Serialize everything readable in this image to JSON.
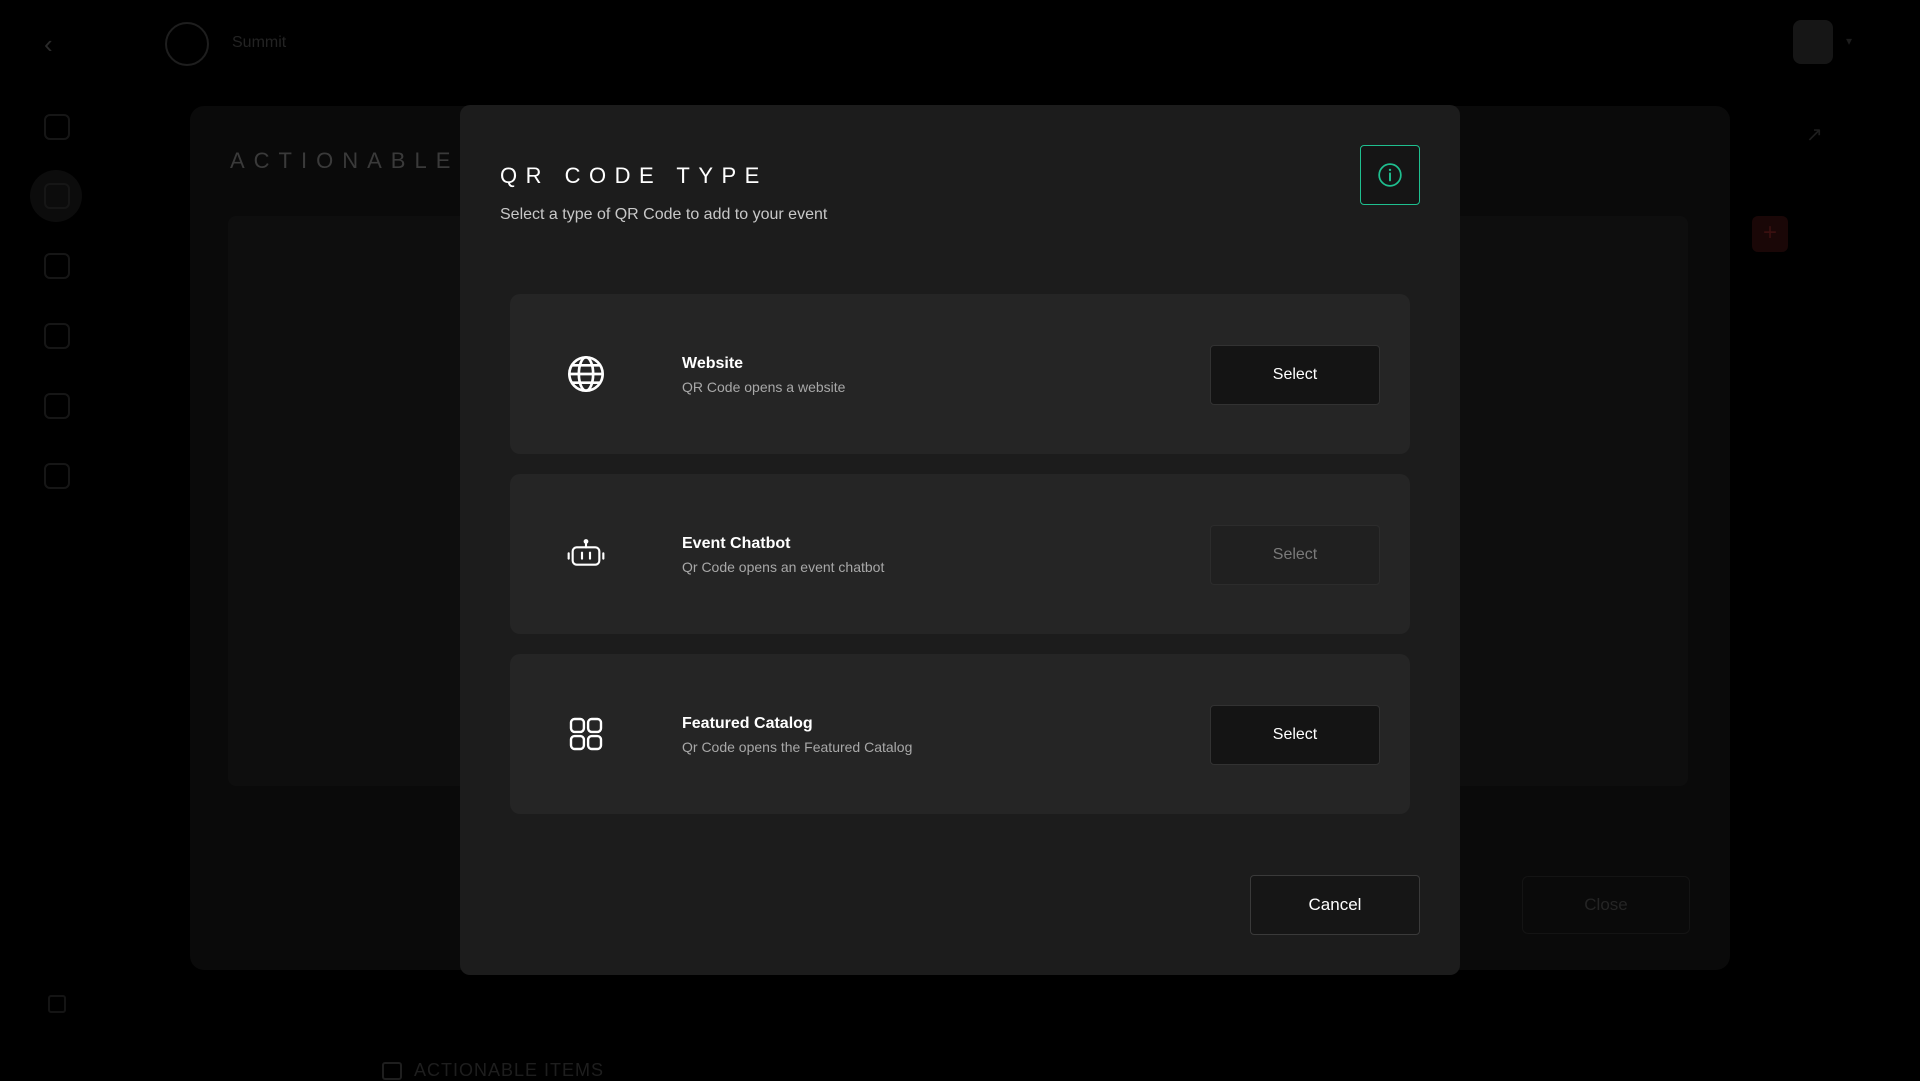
{
  "background": {
    "brand_name": "Summit",
    "page_title": "ACTIONABLE I",
    "close_label": "Close",
    "footer_label": "ACTIONABLE ITEMS"
  },
  "modal": {
    "title": "QR CODE TYPE",
    "subtitle": "Select a type of QR Code to add to your event",
    "info_icon": "info-icon",
    "accent_color": "#1fbf8f",
    "options": [
      {
        "title": "Website",
        "description": "QR Code opens a website",
        "icon": "globe-icon",
        "button_label": "Select",
        "enabled": true
      },
      {
        "title": "Event Chatbot",
        "description": "Qr Code opens an event chatbot",
        "icon": "robot-icon",
        "button_label": "Select",
        "enabled": false
      },
      {
        "title": "Featured Catalog",
        "description": "Qr Code opens the Featured Catalog",
        "icon": "grid-icon",
        "button_label": "Select",
        "enabled": true
      }
    ],
    "cancel_label": "Cancel"
  }
}
